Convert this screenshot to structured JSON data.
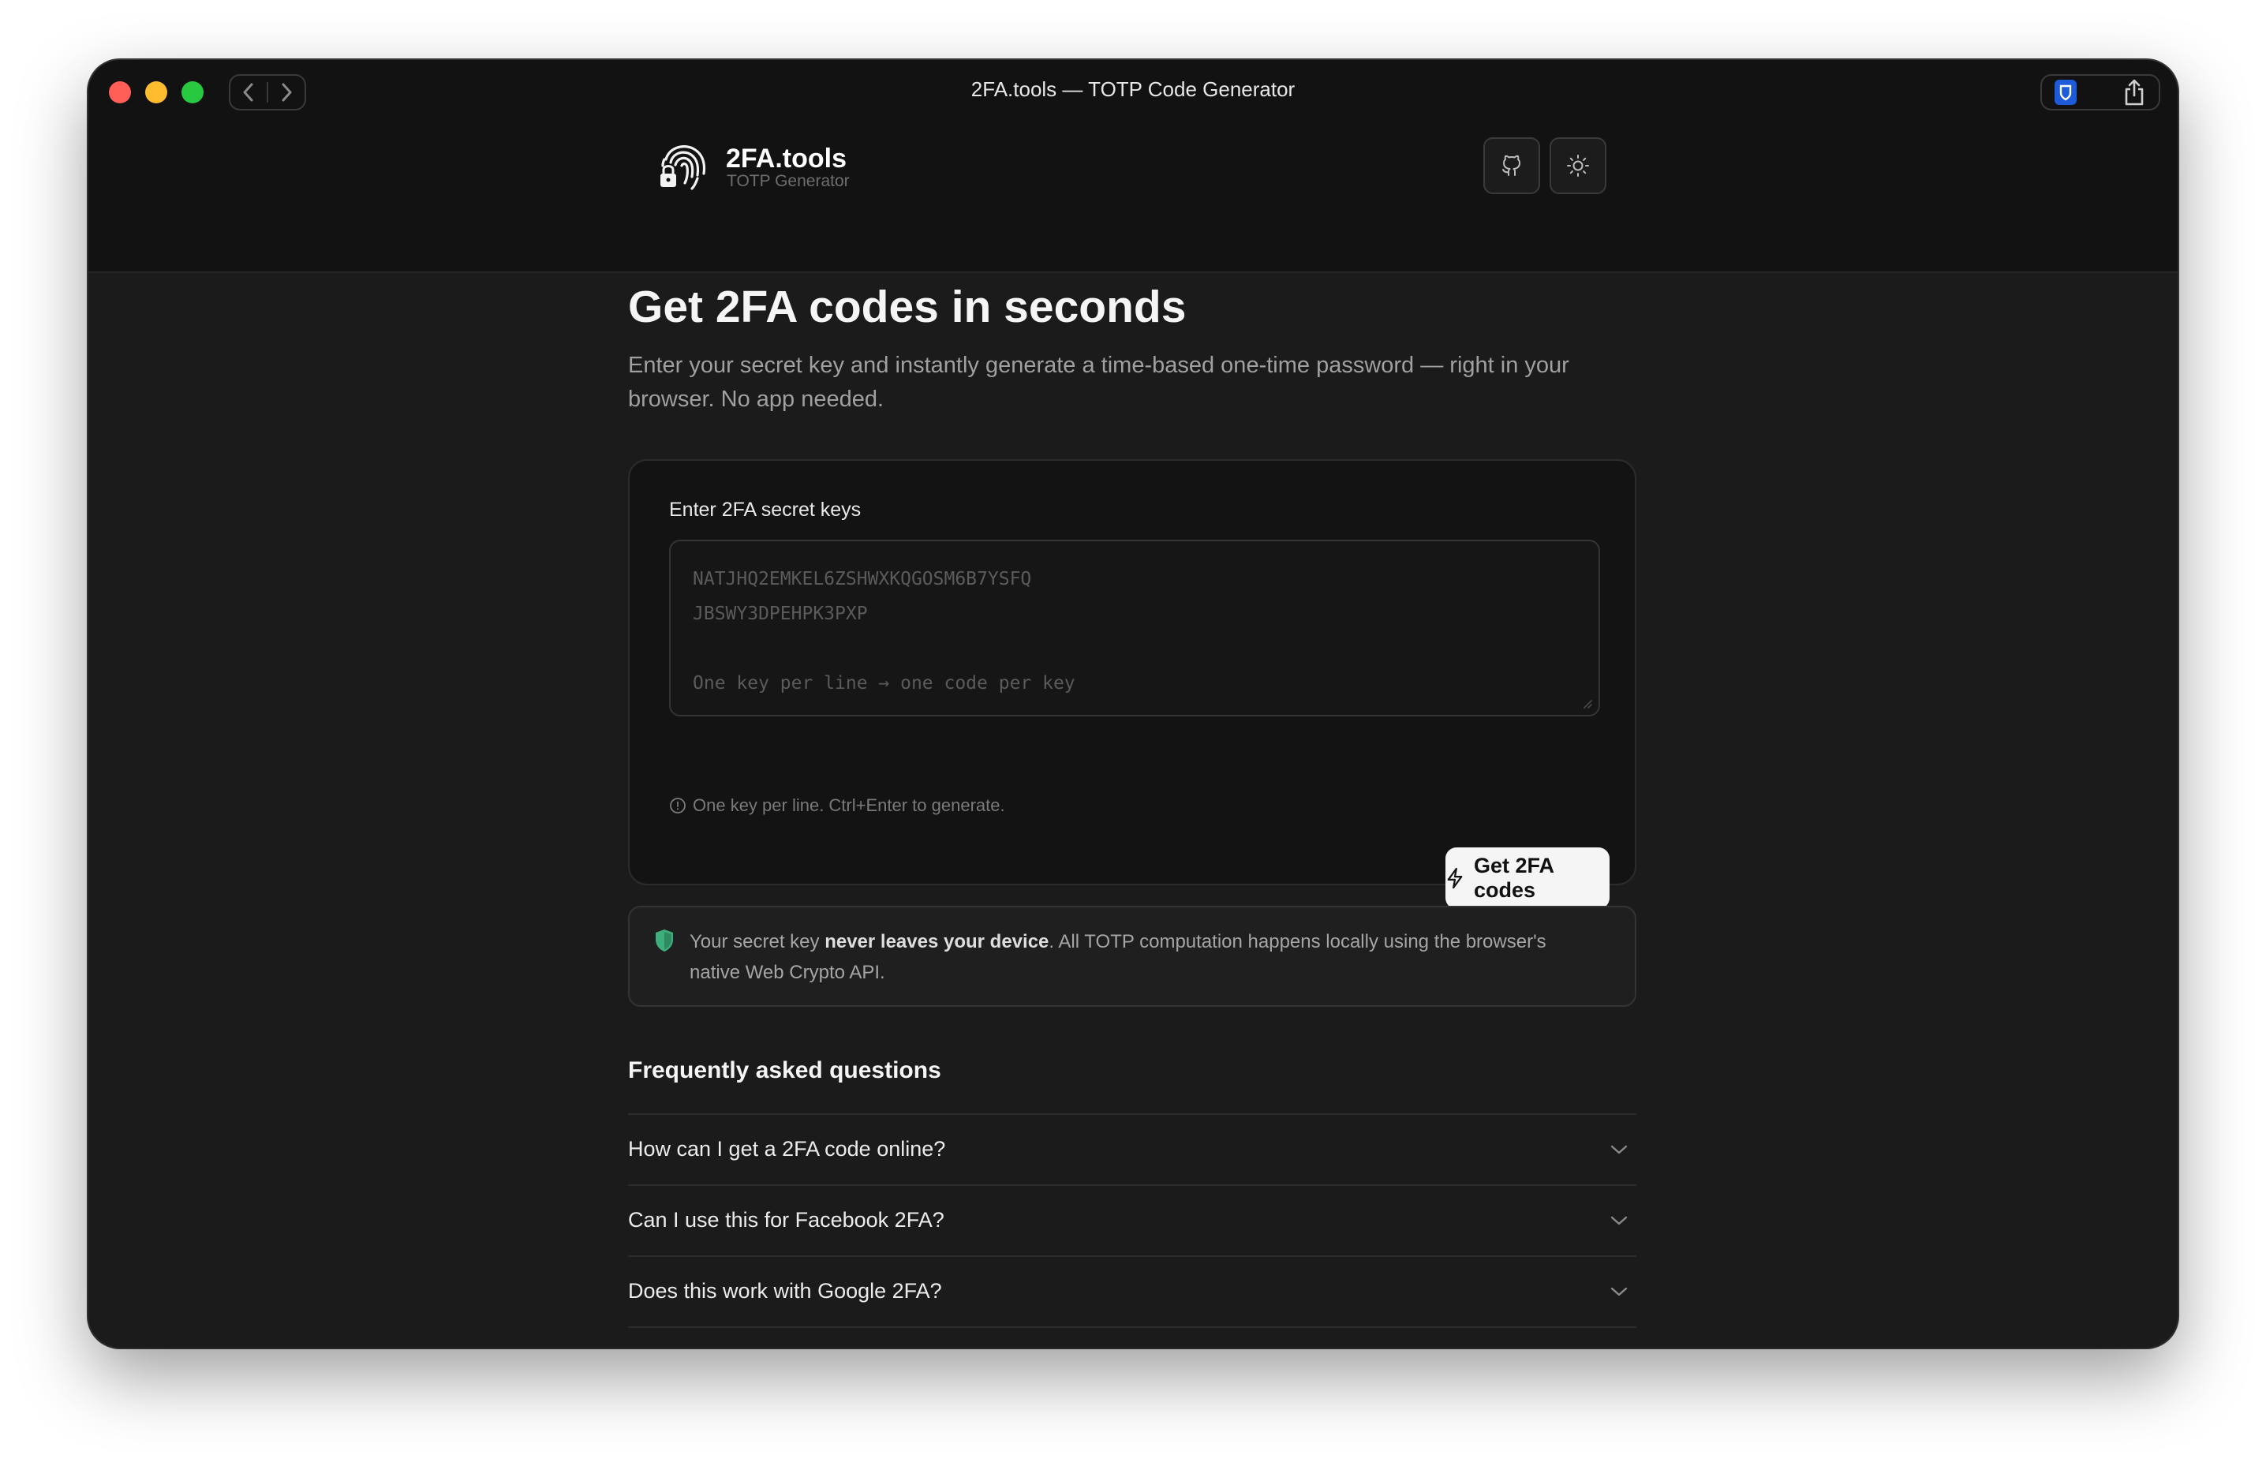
{
  "window": {
    "title": "2FA.tools — TOTP Code Generator"
  },
  "header": {
    "brand_name": "2FA.tools",
    "brand_sub": "TOTP Generator",
    "github_icon": "github-icon",
    "theme_icon": "sun-icon"
  },
  "hero": {
    "title": "Get 2FA codes in seconds",
    "subtitle_line1": "Enter your secret key and instantly generate a time-based one-time password — right in your",
    "subtitle_line2": "browser. No app needed."
  },
  "card": {
    "label": "Enter 2FA secret keys",
    "placeholder_lines": [
      "NATJHQ2EMKEL6ZSHWXKQGOSM6B7YSFQ",
      "JBSWY3DPEHPK3PXP",
      "",
      "One key per line → one code per key"
    ],
    "hint": "One key per line. Ctrl+Enter to generate.",
    "button_label": "Get 2FA codes"
  },
  "notice": {
    "prefix": "Your secret key ",
    "bold": "never leaves your device",
    "suffix_line1": ". All TOTP computation happens locally using the browser's",
    "line2": "native Web Crypto API."
  },
  "faq": {
    "title": "Frequently asked questions",
    "items": [
      "How can I get a 2FA code online?",
      "Can I use this for Facebook 2FA?",
      "Does this work with Google 2FA?"
    ]
  },
  "colors": {
    "background": "#1b1b1b",
    "header": "#121212",
    "accent_shield": "#3fae7d",
    "button_bg": "#f5f5f5"
  }
}
